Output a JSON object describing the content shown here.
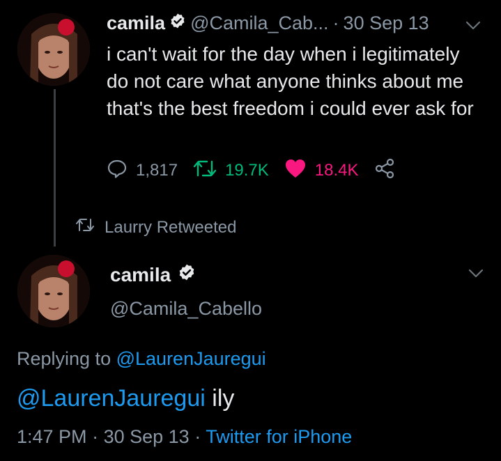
{
  "tweet1": {
    "display_name": "camila",
    "handle": "@Camila_Cab...",
    "separator": "·",
    "date": "30 Sep 13",
    "text": "i can't wait for the day when i legitimately do not care what anyone thinks about me that's the best freedom i could ever ask for",
    "replies": "1,817",
    "retweets": "19.7K",
    "likes": "18.4K"
  },
  "retweeted_by": "Laurry Retweeted",
  "tweet2": {
    "display_name": "camila",
    "handle": "@Camila_Cabello",
    "replying_prefix": "Replying to",
    "replying_to": "@LaurenJauregui",
    "mention": "@LaurenJauregui",
    "text": "ily",
    "time": "1:47 PM",
    "separator1": "·",
    "date": "30 Sep 13",
    "separator2": "·",
    "source": "Twitter for iPhone"
  },
  "colors": {
    "background": "#000000",
    "text": "#e7e9ea",
    "muted": "#8b98a5",
    "link": "#1d9bf0",
    "retweet": "#00ba7c",
    "like": "#f91880"
  },
  "icons": [
    "avatar",
    "verified-badge-icon",
    "chevron-down-icon",
    "reply-icon",
    "retweet-icon",
    "heart-icon",
    "share-icon"
  ]
}
